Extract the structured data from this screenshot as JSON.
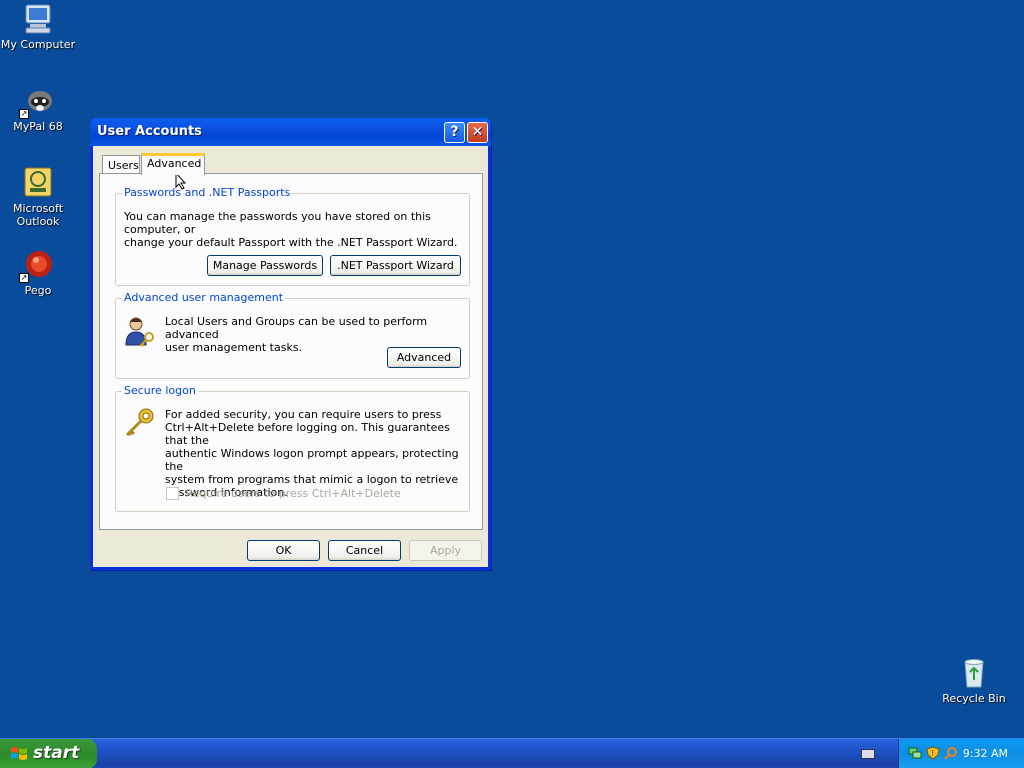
{
  "desktop": {
    "icons": [
      {
        "label": "My Computer",
        "icon": "computer-icon"
      },
      {
        "label": "MyPal 68",
        "icon": "raccoon-icon"
      },
      {
        "label": "Microsoft Outlook",
        "icon": "outlook-icon"
      },
      {
        "label": "Pego",
        "icon": "pego-icon"
      },
      {
        "label": "Recycle Bin",
        "icon": "recycle-bin-icon"
      }
    ]
  },
  "window": {
    "title": "User Accounts",
    "tabs": [
      {
        "label": "Users",
        "active": false
      },
      {
        "label": "Advanced",
        "active": true
      }
    ],
    "passwords_group": {
      "title": "Passwords and .NET Passports",
      "text_line1": "You can manage the passwords you have stored on this computer, or",
      "text_line2": "change your default Passport with the .NET Passport Wizard.",
      "manage_button": "Manage Passwords",
      "wizard_button": ".NET Passport Wizard"
    },
    "advanced_group": {
      "title": "Advanced user management",
      "text_line1": "Local Users and Groups can be used to perform advanced",
      "text_line2": "user management tasks.",
      "advanced_button": "Advanced"
    },
    "secure_group": {
      "title": "Secure logon",
      "text_lines": [
        "For added security, you can require users to press",
        "Ctrl+Alt+Delete before logging on. This guarantees that the",
        "authentic Windows logon prompt appears, protecting the",
        "system from programs that mimic a logon to retrieve",
        "password information."
      ],
      "checkbox_label": "Require users to press Ctrl+Alt+Delete",
      "checkbox_checked": false,
      "checkbox_enabled": false
    },
    "ok_button": "OK",
    "cancel_button": "Cancel",
    "apply_button": "Apply"
  },
  "taskbar": {
    "start_label": "start",
    "clock": "9:32 AM"
  },
  "colors": {
    "desktop": "#0a4c9c",
    "titlebar": "#0545d3",
    "group_title": "#0046d5",
    "start_button": "#3c9a3a"
  }
}
